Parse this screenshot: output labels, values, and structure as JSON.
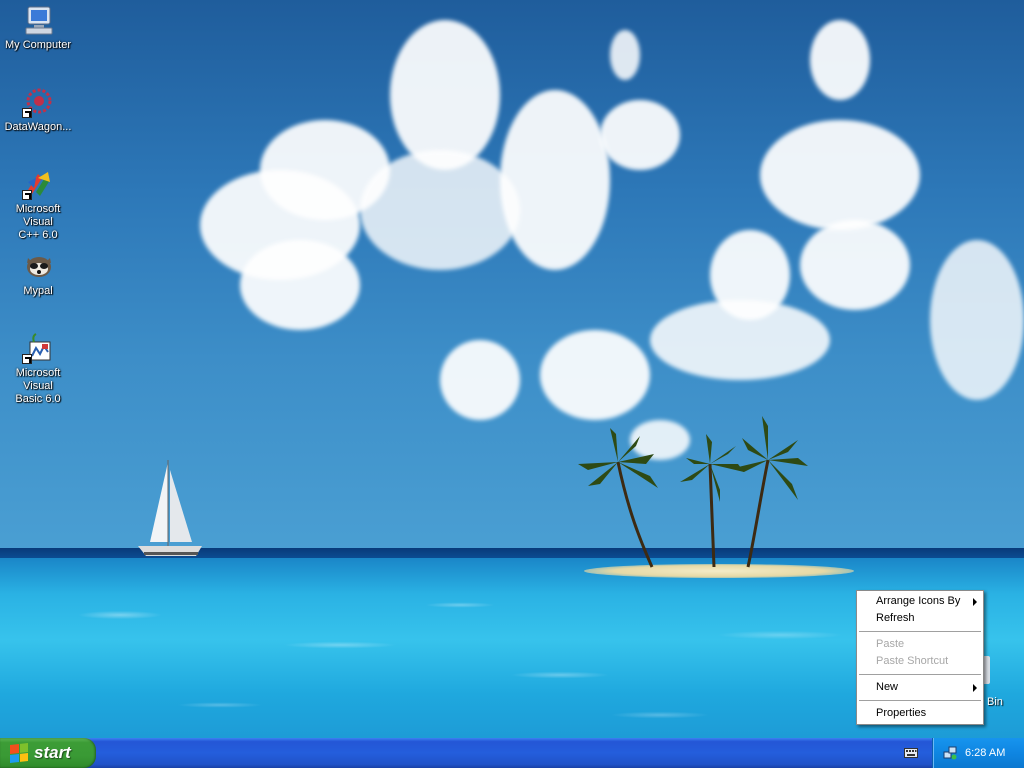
{
  "desktop_icons": [
    {
      "label": "My Computer",
      "icon": "my-computer-icon"
    },
    {
      "label": "DataWagon...",
      "icon": "datawagon-icon"
    },
    {
      "label": "Microsoft Visual\nC++ 6.0",
      "icon": "visual-cpp-icon"
    },
    {
      "label": "Mypal",
      "icon": "mypal-icon"
    },
    {
      "label": "Microsoft Visual\nBasic 6.0",
      "icon": "visual-basic-icon"
    }
  ],
  "recycle_bin": {
    "label_partial": "Bin",
    "icon": "recycle-bin-icon"
  },
  "context_menu": {
    "items": [
      {
        "label": "Arrange Icons By",
        "submenu": true,
        "disabled": false
      },
      {
        "label": "Refresh",
        "submenu": false,
        "disabled": false
      },
      {
        "label": "Paste",
        "submenu": false,
        "disabled": true
      },
      {
        "label": "Paste Shortcut",
        "submenu": false,
        "disabled": true
      },
      {
        "label": "New",
        "submenu": true,
        "disabled": false
      },
      {
        "label": "Properties",
        "submenu": false,
        "disabled": false
      }
    ]
  },
  "taskbar": {
    "start_label": "start",
    "clock": "6:28 AM",
    "tray_icons": [
      "keyboard-icon",
      "network-icon"
    ]
  },
  "colors": {
    "taskbar": "#245edc",
    "start_button": "#3a9a35",
    "tray": "#0f86e2"
  }
}
